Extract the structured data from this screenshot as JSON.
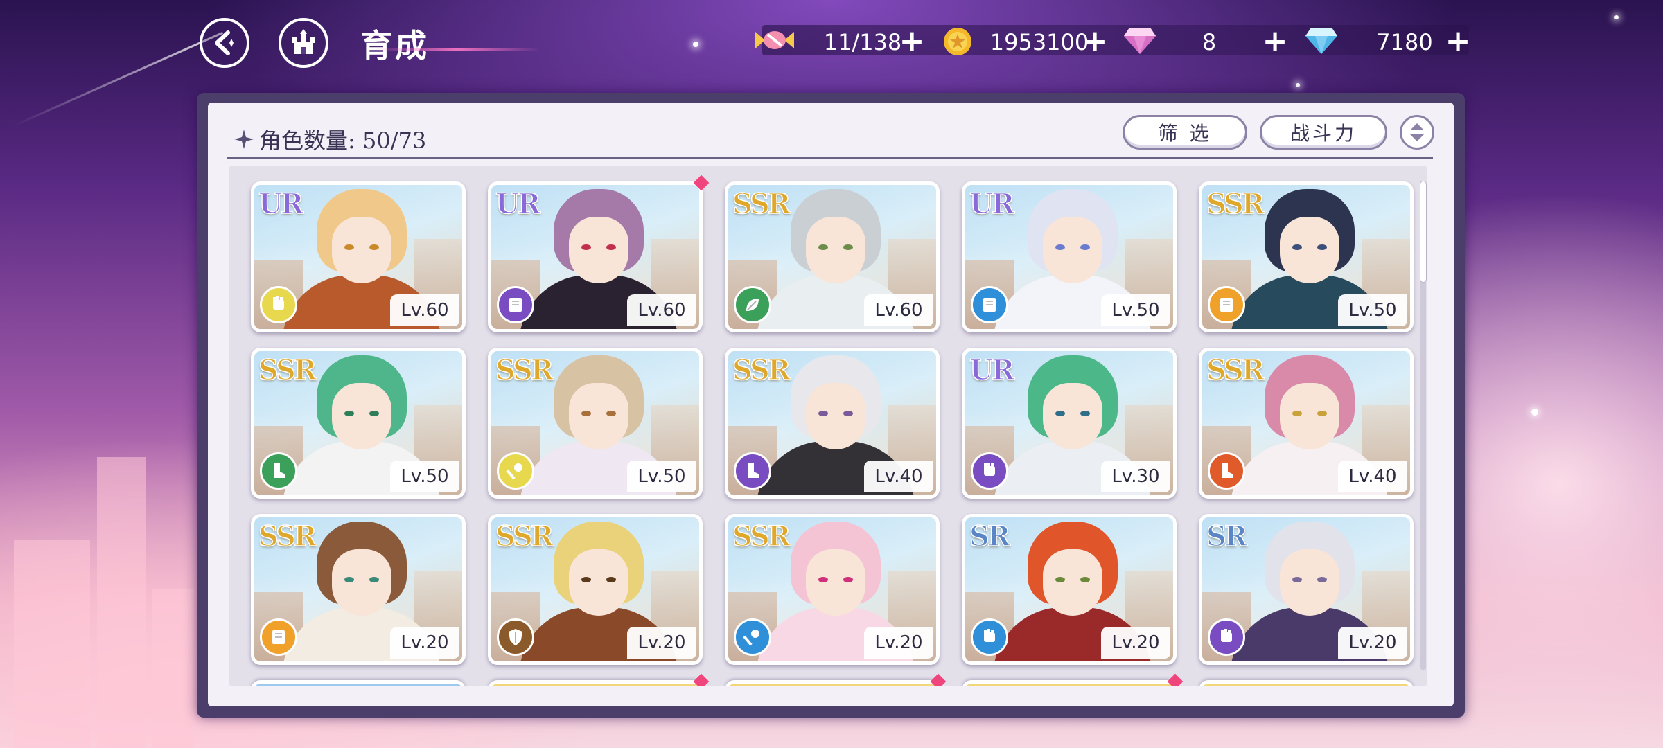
{
  "header": {
    "title": "育成",
    "back_icon": "back-arrow-icon",
    "home_icon": "castle-icon"
  },
  "resources": [
    {
      "name": "candy",
      "icon": "candy-icon",
      "value": "11/138",
      "color": "#f7a1b7"
    },
    {
      "name": "gold",
      "icon": "gold-coin-icon",
      "value": "1953100",
      "color": "#f5c542"
    },
    {
      "name": "pink-gem",
      "icon": "pink-diamond-icon",
      "value": "8",
      "color": "#e788d8"
    },
    {
      "name": "blue-gem",
      "icon": "blue-diamond-icon",
      "value": "7180",
      "color": "#7fd4f5"
    }
  ],
  "panel": {
    "count_label": "角色数量: 50/73",
    "filter_label": "筛 选",
    "sort_label": "战斗力"
  },
  "cards": [
    {
      "rarity": "UR",
      "level": "Lv.60",
      "class_icon": "fist-icon",
      "class_color": "#e8d84e",
      "hair": "#f0c98a",
      "eye": "#c98a2a",
      "cloth": "#b85a2c"
    },
    {
      "rarity": "UR",
      "level": "Lv.60",
      "class_icon": "book-icon",
      "class_color": "#7a4cc2",
      "hair": "#a57aa8",
      "eye": "#c0304a",
      "cloth": "#2a2230",
      "marked": true
    },
    {
      "rarity": "SSR",
      "level": "Lv.60",
      "class_icon": "leaf-icon",
      "class_color": "#3ba05a",
      "hair": "#c9cfd2",
      "eye": "#6c8c4a",
      "cloth": "#e9eef0"
    },
    {
      "rarity": "UR",
      "level": "Lv.50",
      "class_icon": "book-icon",
      "class_color": "#2f8fd8",
      "hair": "#dfe3f2",
      "eye": "#6a7bd0",
      "cloth": "#f2f4fa"
    },
    {
      "rarity": "SSR",
      "level": "Lv.50",
      "class_icon": "book-icon",
      "class_color": "#f0a12a",
      "hair": "#2c3450",
      "eye": "#3c4f7a",
      "cloth": "#274b5c"
    },
    {
      "rarity": "SSR",
      "level": "Lv.50",
      "class_icon": "boot-icon",
      "class_color": "#3ba05a",
      "hair": "#4fb58a",
      "eye": "#2f7f5a",
      "cloth": "#f3f3f3"
    },
    {
      "rarity": "SSR",
      "level": "Lv.50",
      "class_icon": "wand-icon",
      "class_color": "#e8d84e",
      "hair": "#d8c2a4",
      "eye": "#a8703a",
      "cloth": "#efe8f3"
    },
    {
      "rarity": "SSR",
      "level": "Lv.40",
      "class_icon": "boot-icon",
      "class_color": "#7a4cc2",
      "hair": "#e8e8ec",
      "eye": "#7b5a9a",
      "cloth": "#333036"
    },
    {
      "rarity": "UR",
      "level": "Lv.30",
      "class_icon": "fist-icon",
      "class_color": "#7a4cc2",
      "hair": "#4cb88a",
      "eye": "#2f6f8a",
      "cloth": "#ebeef2"
    },
    {
      "rarity": "SSR",
      "level": "Lv.40",
      "class_icon": "boot-icon",
      "class_color": "#e05a2a",
      "hair": "#d88aa8",
      "eye": "#c9a23a",
      "cloth": "#f6f0f2"
    },
    {
      "rarity": "SSR",
      "level": "Lv.20",
      "class_icon": "book-icon",
      "class_color": "#f0a12a",
      "hair": "#8a5a3a",
      "eye": "#3a8a7a",
      "cloth": "#f2ece2"
    },
    {
      "rarity": "SSR",
      "level": "Lv.20",
      "class_icon": "shield-icon",
      "class_color": "#8a5a2a",
      "hair": "#e9d27a",
      "eye": "#5a3a1a",
      "cloth": "#8a4a2a"
    },
    {
      "rarity": "SSR",
      "level": "Lv.20",
      "class_icon": "wand-icon",
      "class_color": "#2f8fd8",
      "hair": "#f4c4d4",
      "eye": "#d0307a",
      "cloth": "#f7d8e4"
    },
    {
      "rarity": "SR",
      "level": "Lv.20",
      "class_icon": "fist-icon",
      "class_color": "#2f8fd8",
      "hair": "#e0552a",
      "eye": "#6a8a3a",
      "cloth": "#9a2a2a"
    },
    {
      "rarity": "SR",
      "level": "Lv.20",
      "class_icon": "fist-icon",
      "class_color": "#7a4cc2",
      "hair": "#e2e2ea",
      "eye": "#7a6a9a",
      "cloth": "#4a3a6a"
    }
  ],
  "colors": {
    "rarity_ur": "#8a6ad8",
    "rarity_ssr": "#e0a82a",
    "rarity_sr": "#5a86c8"
  }
}
